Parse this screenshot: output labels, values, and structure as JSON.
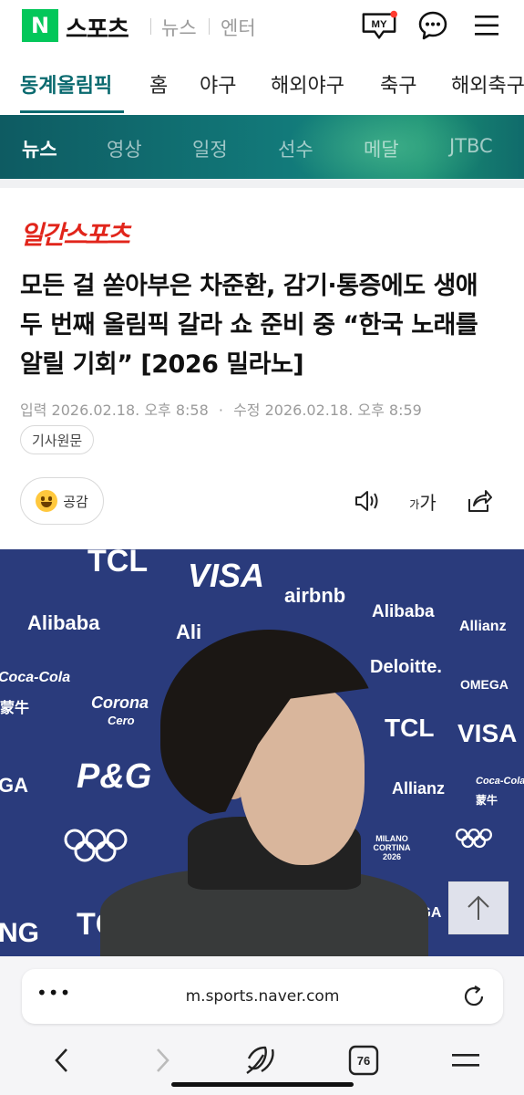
{
  "header": {
    "logo_letter": "N",
    "brand": "스포츠",
    "links": [
      "뉴스",
      "엔터"
    ],
    "my_badge": "MY"
  },
  "sport_tabs": [
    "동계올림픽",
    "홈",
    "야구",
    "해외야구",
    "축구",
    "해외축구"
  ],
  "sport_tab_active": "동계올림픽",
  "sub_nav": [
    "뉴스",
    "영상",
    "일정",
    "선수",
    "메달",
    "JTBC"
  ],
  "sub_nav_active": "뉴스",
  "article": {
    "press": "일간스포츠",
    "headline": "모든 걸 쏟아부은 차준환, 감기·통증에도 생애 두 번째 올림픽 갈라 쇼 준비 중 “한국 노래를 알릴 기회” [2026 밀라노]",
    "input_label": "입력",
    "input_date": "2026.02.18. 오후 8:58",
    "modify_label": "수정",
    "modify_date": "2026.02.18. 오후 8:59",
    "original_button": "기사원문",
    "reaction_label": "공감",
    "font_size_small": "가",
    "font_size_large": "가"
  },
  "photo": {
    "sponsors": [
      "TCL",
      "VISA",
      "airbnb",
      "Alibaba",
      "Alibaba",
      "Allianz",
      "Deloitte.",
      "Coca-Cola",
      "蒙牛",
      "Corona",
      "Cero",
      "OMEGA",
      "TCL",
      "VISA",
      "P&G",
      "Allianz",
      "Coca-Cola",
      "蒙牛",
      "MILANO CORTINA 2026",
      "OMEGA",
      "TC",
      "NG",
      "GA",
      "Ali"
    ]
  },
  "browser": {
    "url": "m.sports.naver.com",
    "tab_count": "76"
  },
  "colors": {
    "naver_green": "#03c75a",
    "olympic_teal": "#0a6a6f",
    "press_red": "#e1251b",
    "photo_backdrop": "#2a3b7c"
  }
}
